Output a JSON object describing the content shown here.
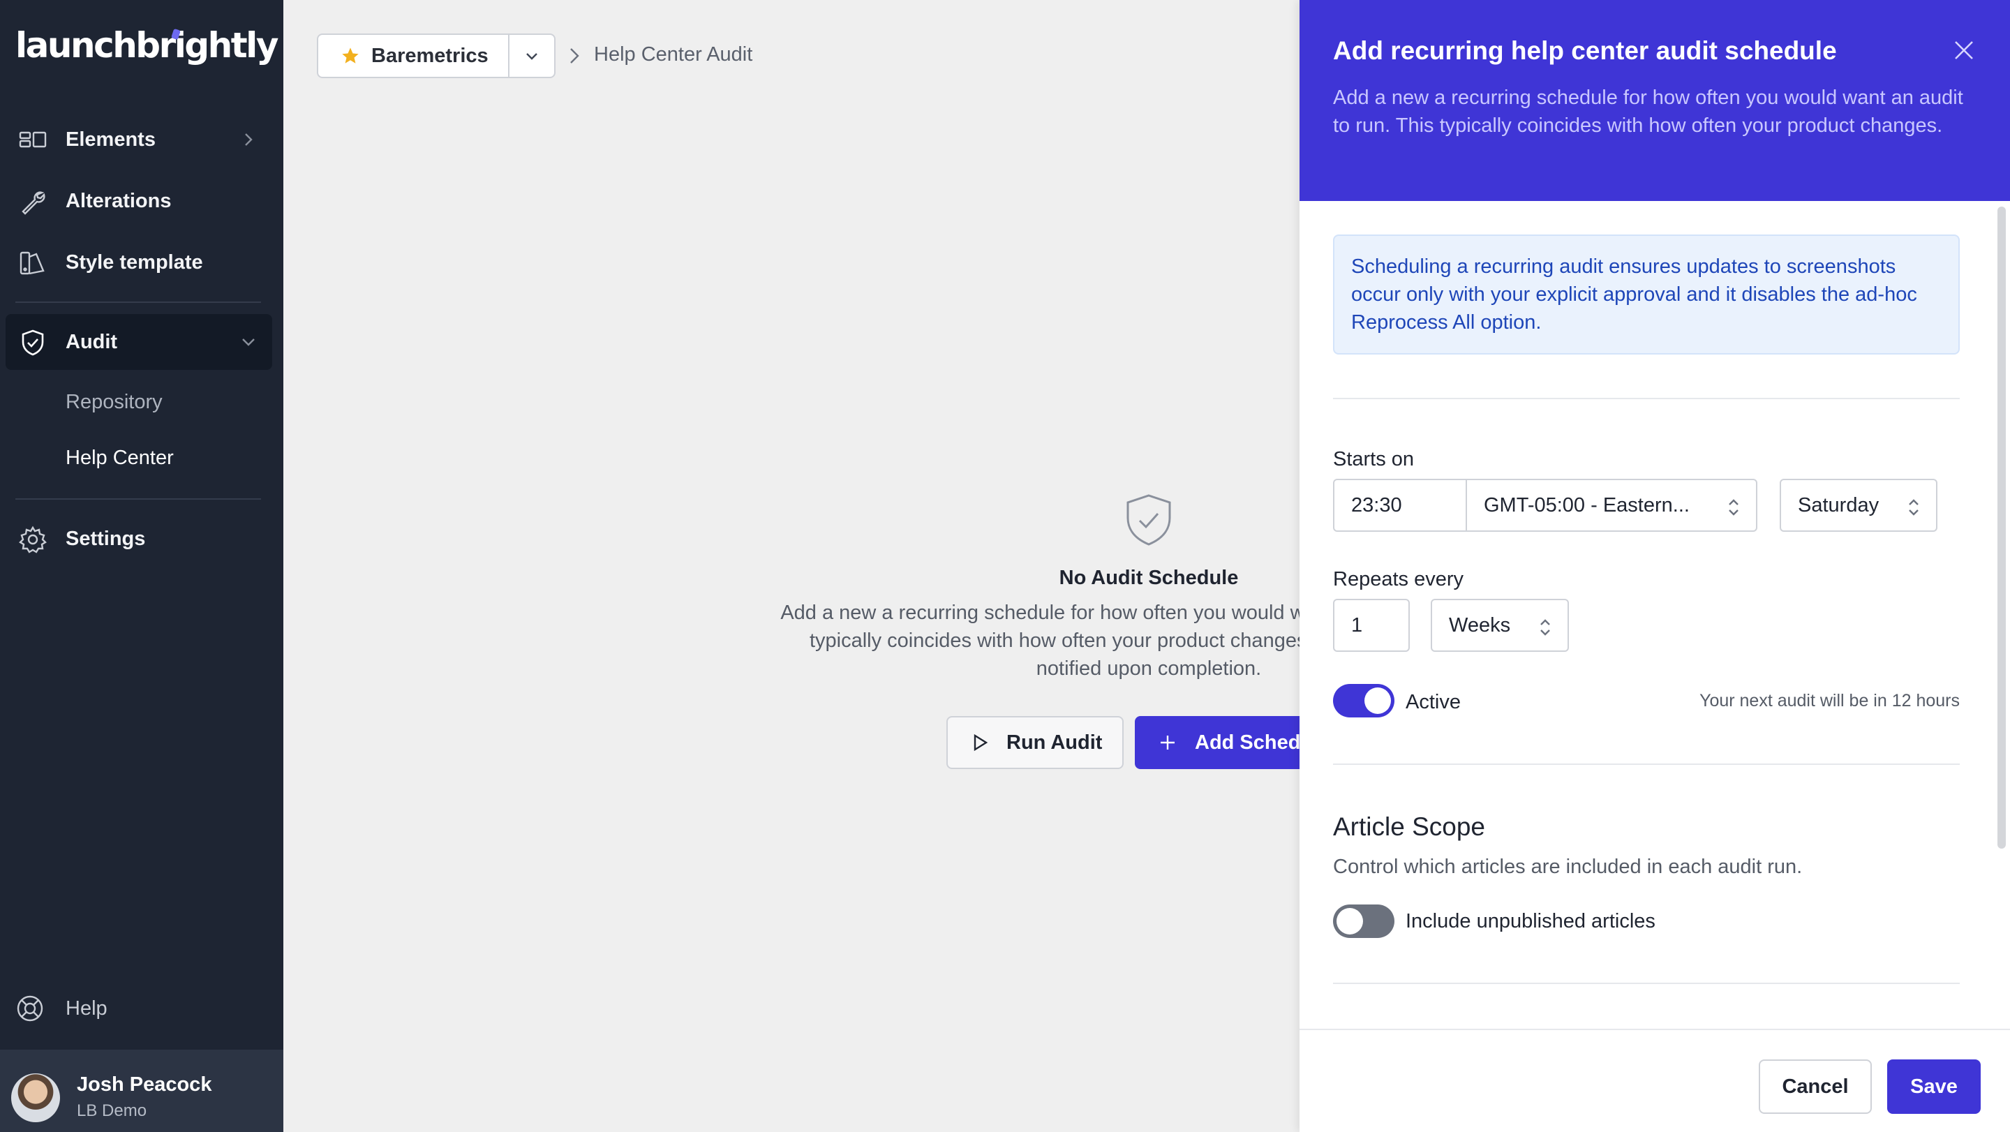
{
  "logo": {
    "text": "launchbrightly"
  },
  "sidebar": {
    "items": [
      {
        "label": "Elements",
        "icon": "elements-icon"
      },
      {
        "label": "Alterations",
        "icon": "wrench-icon"
      },
      {
        "label": "Style template",
        "icon": "style-template-icon"
      },
      {
        "label": "Audit",
        "icon": "shield-check-icon"
      },
      {
        "label": "Settings",
        "icon": "gear-icon"
      }
    ],
    "audit_sub": [
      {
        "label": "Repository"
      },
      {
        "label": "Help Center"
      }
    ],
    "help_label": "Help",
    "user": {
      "name": "Josh Peacock",
      "org": "LB Demo"
    }
  },
  "breadcrumb": {
    "project": "Baremetrics",
    "page": "Help Center Audit"
  },
  "empty_state": {
    "title": "No Audit Schedule",
    "description": "Add a new a recurring schedule for how often you would want an audit to run. This typically coincides with how often your product changes, and who should be notified upon completion.",
    "run_label": "Run Audit",
    "add_label": "Add Schedule"
  },
  "panel": {
    "title": "Add recurring help center audit schedule",
    "subtitle": "Add a new a recurring schedule for how often you would want an audit to run. This typically coincides with how often your product changes.",
    "info": "Scheduling a recurring audit ensures updates to screenshots occur only with your explicit approval and it disables the ad-hoc Reprocess All option.",
    "starts_on_label": "Starts on",
    "time_value": "23:30",
    "timezone_value": "GMT-05:00 - Eastern...",
    "day_value": "Saturday",
    "repeats_label": "Repeats every",
    "repeat_count": "1",
    "repeat_unit": "Weeks",
    "active_label": "Active",
    "active_on": true,
    "next_audit": "Your next audit will be in 12 hours",
    "scope_title": "Article Scope",
    "scope_desc": "Control which articles are included in each audit run.",
    "unpublished_label": "Include unpublished articles",
    "unpublished_on": false,
    "cancel_label": "Cancel",
    "save_label": "Save"
  },
  "colors": {
    "accent": "#3f35d6",
    "sidebar_bg": "#1e2533",
    "info_text": "#1e46b8",
    "star": "#f2b01e"
  }
}
